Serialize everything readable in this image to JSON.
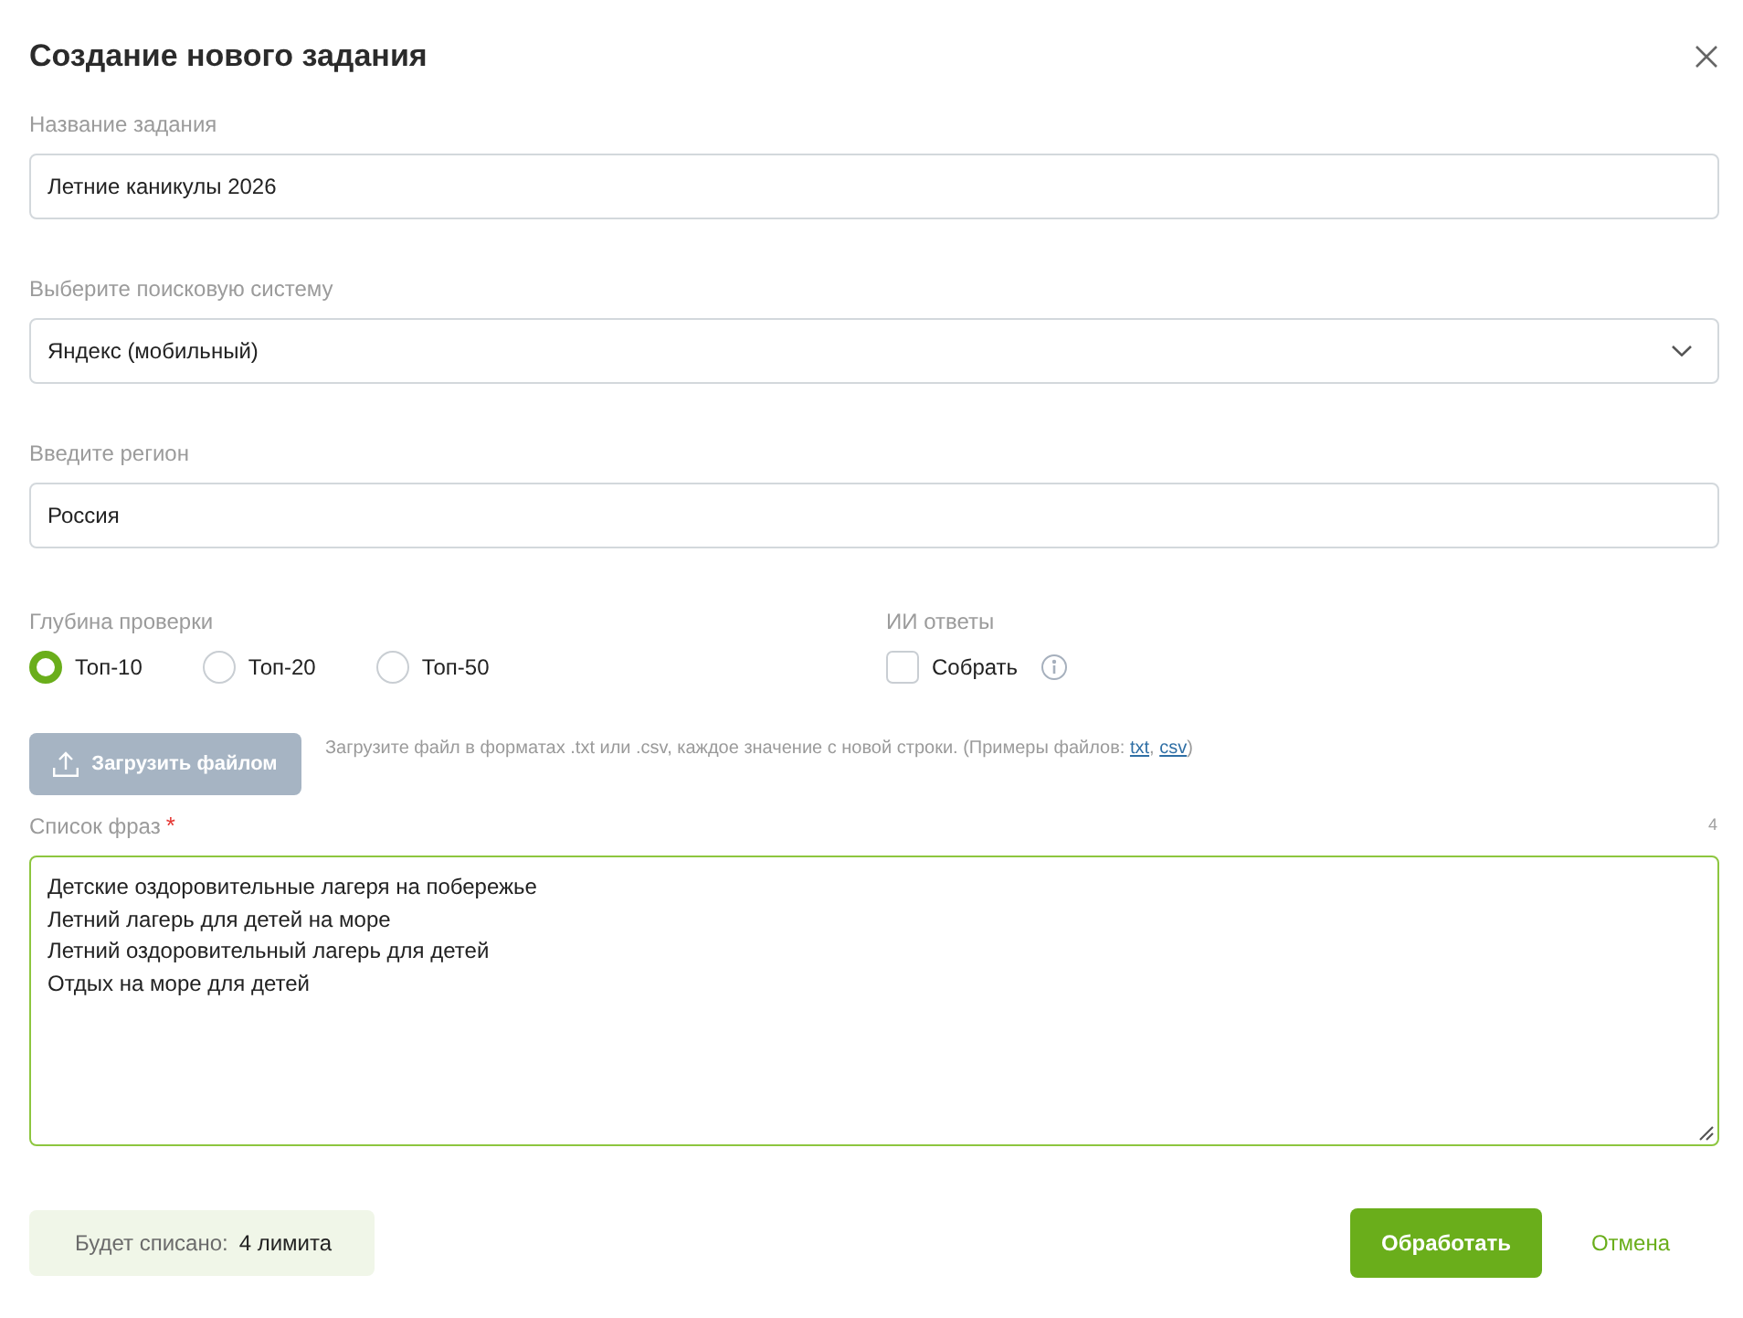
{
  "dialog": {
    "title": "Создание нового задания"
  },
  "fields": [
    {
      "kind": "text",
      "label": "Название задания",
      "value": "Летние каникулы 2026"
    },
    {
      "kind": "select",
      "label": "Выберите поисковую систему",
      "value": "Яндекс (мобильный)"
    },
    {
      "kind": "text",
      "label": "Введите регион",
      "value": "Россия"
    }
  ],
  "depth": {
    "label": "Глубина проверки",
    "options": [
      {
        "label": "Топ-10",
        "selected": true
      },
      {
        "label": "Топ-20",
        "selected": false
      },
      {
        "label": "Топ-50",
        "selected": false
      }
    ]
  },
  "ai_answers": {
    "label": "ИИ ответы",
    "checkbox": {
      "label": "Собрать",
      "checked": false
    }
  },
  "upload": {
    "button": {
      "label": "Загрузить файлом",
      "disabled": true
    },
    "hint": [
      {
        "kind": "text",
        "text": "Загрузите файл в форматах .txt или .csv, каждое значение с новой строки. (Примеры файлов: "
      },
      {
        "kind": "link",
        "text": "txt"
      },
      {
        "kind": "text",
        "text": ", "
      },
      {
        "kind": "link",
        "text": "csv"
      },
      {
        "kind": "text",
        "text": ")"
      }
    ]
  },
  "phrases": {
    "label": "Список фраз",
    "required_mark": "*",
    "count": "4",
    "focused": true,
    "lines": [
      "Детские оздоровительные лагеря на побережье",
      "Летний лагерь для детей на море",
      "Летний оздоровительный лагерь для детей",
      "Отдых на море для детей"
    ]
  },
  "footer": {
    "cost_label": "Будет списано:",
    "cost_value": "4 лимита",
    "buttons": [
      {
        "kind": "primary",
        "label": "Обработать"
      },
      {
        "kind": "link",
        "label": "Отмена"
      }
    ]
  }
}
